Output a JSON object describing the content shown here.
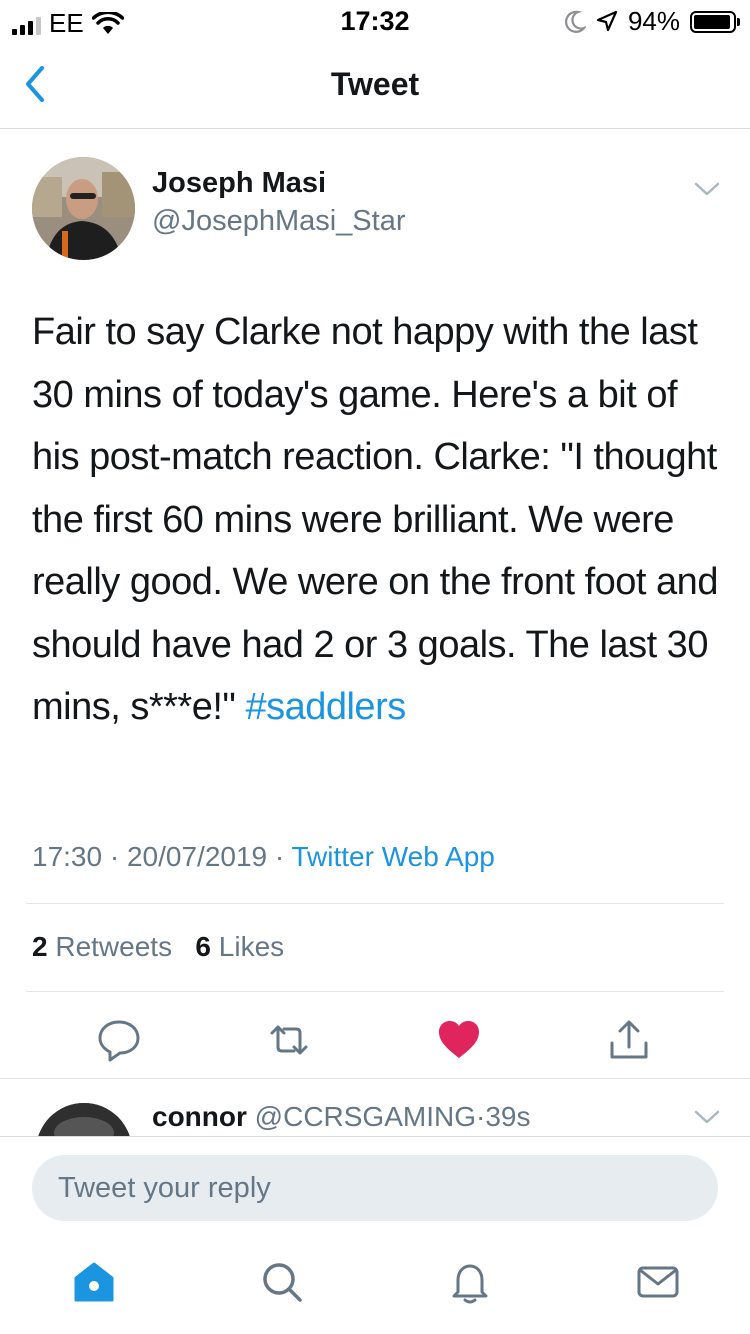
{
  "status": {
    "carrier": "EE",
    "time": "17:32",
    "battery": "94%",
    "battery_level": 0.94
  },
  "nav": {
    "title": "Tweet"
  },
  "tweet": {
    "author_name": "Joseph Masi",
    "author_handle": "@JosephMasi_Star",
    "text": "Fair to say Clarke not happy with the last 30 mins of today's game. Here's a bit of his post-match reaction. Clarke: \"I thought the first 60 mins were brilliant. We were really good. We were on the front foot and should have had 2 or 3 goals. The last 30 mins, s***e!\"",
    "hashtag": "#saddlers",
    "time": "17:30",
    "date": "20/07/2019",
    "source": "Twitter Web App",
    "separator": "·",
    "retweets_count": "2",
    "retweets_label": "Retweets",
    "likes_count": "6",
    "likes_label": "Likes",
    "liked": true
  },
  "reply_preview": {
    "name": "connor",
    "handle": "@CCRSGAMING",
    "separator": "·",
    "age": "39s"
  },
  "composer": {
    "placeholder": "Tweet your reply"
  },
  "colors": {
    "accent": "#1b95e0",
    "like": "#e0245e",
    "secondary_text": "#657786"
  }
}
